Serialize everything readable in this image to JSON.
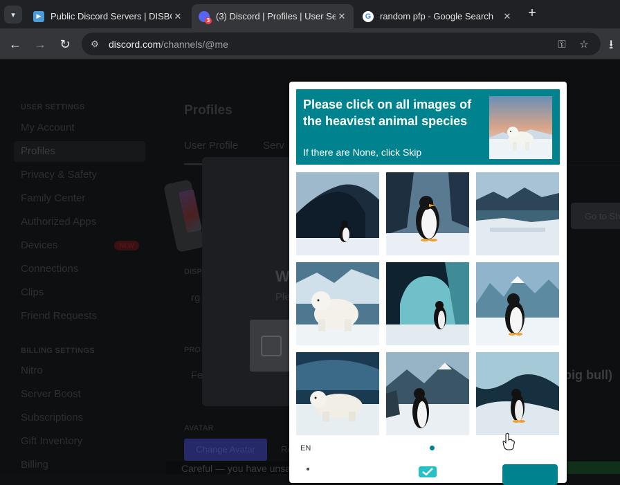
{
  "browser": {
    "tabs": [
      {
        "title": "Public Discord Servers | DISBOARD",
        "favicon": "disboard-icon",
        "active": false
      },
      {
        "title": "(3) Discord | Profiles | User Settings",
        "favicon": "discord-icon",
        "badge": "3",
        "active": true
      },
      {
        "title": "random pfp - Google Search",
        "favicon": "google-icon",
        "active": false
      }
    ],
    "new_tab": "+",
    "url_domain": "discord.com",
    "url_path": "/channels/@me"
  },
  "discord": {
    "user_settings_header": "USER SETTINGS",
    "user_items": [
      "My Account",
      "Profiles",
      "Privacy & Safety",
      "Family Center",
      "Authorized Apps",
      "Devices",
      "Connections",
      "Clips",
      "Friend Requests"
    ],
    "new_badge": "NEW",
    "billing_header": "BILLING SETTINGS",
    "billing_items": [
      "Nitro",
      "Server Boost",
      "Subscriptions",
      "Gift Inventory",
      "Billing"
    ],
    "page_title": "Profiles",
    "tab_user_profile": "User Profile",
    "tab_server": "Serv",
    "label_display": "DISP",
    "value_display": "rg",
    "label_pronouns": "PRO",
    "value_pronouns": "Fe",
    "label_avatar": "AVATAR",
    "change_avatar": "Change Avatar",
    "remove_avatar_partial": "Re",
    "goto_shop": "Go to Sh",
    "bigbull": "big bull)",
    "modal_heading_partial": "W",
    "modal_sub_partial": "Ple",
    "careful_banner": "Careful — you have unsaved changes!"
  },
  "captcha": {
    "prompt": "Please click on all images of the heaviest animal species",
    "sub": "If there are None, click Skip",
    "sample_image": "polar-bear",
    "images": [
      "penguin-ice-cave",
      "penguin-close",
      "arctic-landscape",
      "polar-bear-cub",
      "penguin-glacier",
      "penguin-mountains",
      "polar-bear-walking",
      "penguin-rocks",
      "penguin-ice-arch"
    ],
    "language": "EN",
    "colors": {
      "teal": "#00838f",
      "white": "#ffffff"
    }
  }
}
